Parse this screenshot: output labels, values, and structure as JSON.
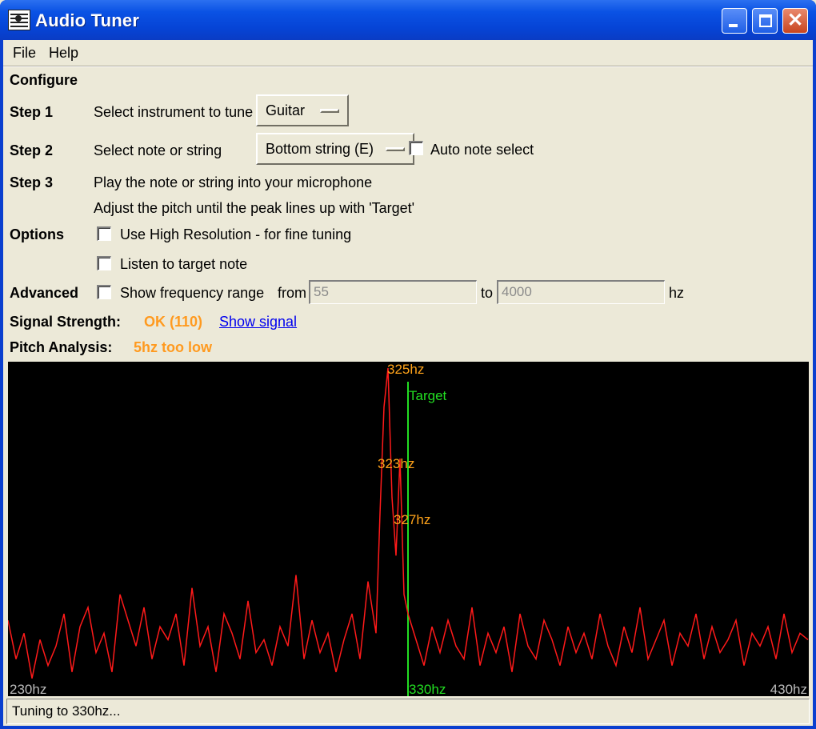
{
  "window": {
    "title": "Audio Tuner"
  },
  "menu": {
    "items": [
      "File",
      "Help"
    ]
  },
  "configure": {
    "heading": "Configure"
  },
  "step1": {
    "label": "Step 1",
    "text": "Select instrument to tune",
    "instrument": "Guitar"
  },
  "step2": {
    "label": "Step 2",
    "text": "Select note or string",
    "note": "Bottom string (E)",
    "auto_label": "Auto note select",
    "auto_checked": false
  },
  "step3": {
    "label": "Step 3",
    "text1": "Play the note or string into your microphone",
    "text2": "Adjust the pitch until the peak lines up with 'Target'"
  },
  "options": {
    "label": "Options",
    "high_res": "Use High Resolution - for fine tuning",
    "listen": "Listen to target note"
  },
  "advanced": {
    "label": "Advanced",
    "show_range": "Show frequency range",
    "from_label": "from",
    "from_value": "55",
    "to_label": "to",
    "to_value": "4000",
    "unit": "hz"
  },
  "signal": {
    "label": "Signal Strength:",
    "value": "OK (110)",
    "link": "Show signal"
  },
  "pitch": {
    "label": "Pitch Analysis:",
    "value": "5hz too low"
  },
  "graph": {
    "min_label": "230hz",
    "max_label": "430hz",
    "target_label": "Target",
    "target_freq_label": "330hz",
    "peak_labels": [
      "325hz",
      "323hz",
      "327hz"
    ],
    "trace_color": "#ff1a1a",
    "target_color": "#22dd22",
    "peak_label_color": "#ffa31a"
  },
  "chart_data": {
    "type": "line",
    "title": "",
    "xlabel": "",
    "ylabel": "",
    "xlim": [
      230,
      430
    ],
    "x_tick_labels": [
      "230hz",
      "430hz"
    ],
    "target_x": 330,
    "peaks": [
      {
        "x": 325,
        "label": "325hz"
      },
      {
        "x": 323,
        "label": "323hz"
      },
      {
        "x": 327,
        "label": "327hz"
      }
    ],
    "series": [
      {
        "x": [
          230,
          232,
          234,
          236,
          238,
          240,
          242,
          244,
          246,
          248,
          250,
          252,
          254,
          256,
          258,
          260,
          262,
          264,
          266,
          268,
          270,
          272,
          274,
          276,
          278,
          280,
          282,
          284,
          286,
          288,
          290,
          292,
          294,
          296,
          298,
          300,
          302,
          304,
          306,
          308,
          310,
          312,
          314,
          316,
          318,
          320,
          322,
          323,
          324,
          325,
          326,
          327,
          328,
          329,
          330,
          332,
          334,
          336,
          338,
          340,
          342,
          344,
          346,
          348,
          350,
          352,
          354,
          356,
          358,
          360,
          362,
          364,
          366,
          368,
          370,
          372,
          374,
          376,
          378,
          380,
          382,
          384,
          386,
          388,
          390,
          392,
          394,
          396,
          398,
          400,
          402,
          404,
          406,
          408,
          410,
          412,
          414,
          416,
          418,
          420,
          422,
          424,
          426,
          428,
          430
        ],
        "y": [
          22,
          10,
          18,
          4,
          16,
          8,
          14,
          24,
          6,
          20,
          26,
          12,
          18,
          6,
          30,
          22,
          14,
          26,
          10,
          20,
          16,
          24,
          8,
          32,
          14,
          20,
          6,
          24,
          18,
          10,
          28,
          12,
          16,
          8,
          20,
          14,
          36,
          10,
          22,
          12,
          18,
          6,
          16,
          24,
          10,
          34,
          18,
          55,
          88,
          100,
          60,
          42,
          72,
          30,
          24,
          16,
          8,
          20,
          12,
          22,
          14,
          10,
          26,
          8,
          18,
          12,
          20,
          6,
          24,
          14,
          10,
          22,
          16,
          8,
          20,
          12,
          18,
          10,
          24,
          14,
          8,
          20,
          12,
          26,
          10,
          16,
          22,
          8,
          18,
          14,
          24,
          10,
          20,
          12,
          16,
          22,
          8,
          18,
          14,
          20,
          10,
          24,
          12,
          18,
          16
        ]
      }
    ],
    "ylim": [
      0,
      100
    ]
  },
  "status": {
    "text": "Tuning to 330hz..."
  }
}
